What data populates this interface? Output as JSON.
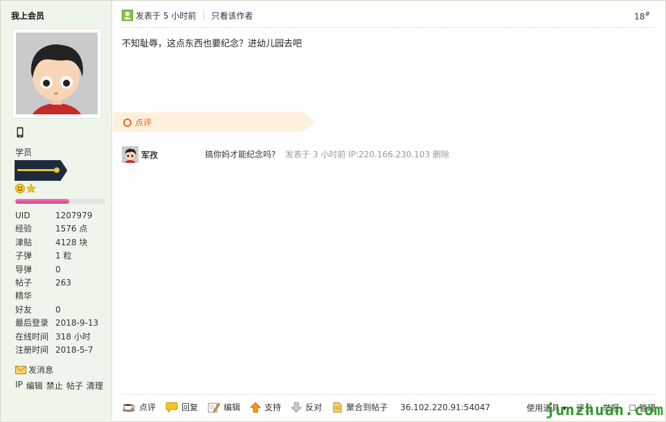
{
  "user": {
    "name": "我上会员",
    "rank": "学员",
    "progress_fraction": 0.6,
    "stats": [
      {
        "label": "UID",
        "value": "1207979"
      },
      {
        "label": "经验",
        "value": "1576 点"
      },
      {
        "label": "津贴",
        "value": "4128 块"
      },
      {
        "label": "子弹",
        "value": "1 粒"
      },
      {
        "label": "导弹",
        "value": "0"
      },
      {
        "label": "帖子",
        "value": "263"
      },
      {
        "label": "精华",
        "value": ""
      },
      {
        "label": "好友",
        "value": "0"
      },
      {
        "label": "最后登录",
        "value": "2018-9-13"
      },
      {
        "label": "在线时间",
        "value": "318 小时"
      },
      {
        "label": "注册时间",
        "value": "2018-5-7"
      }
    ],
    "send_message": "发消息",
    "admin_links": [
      "IP",
      "编辑",
      "禁止",
      "帖子",
      "清理"
    ]
  },
  "post": {
    "posted": "发表于 5 小时前",
    "only_author": "只看该作者",
    "floor": "18",
    "floor_mark": "#",
    "content": "不知耻辱，这点东西也要纪念？进幼儿园去吧"
  },
  "comments": {
    "title": "点评",
    "items": [
      {
        "user": "军孜",
        "text": "搞你妈才能纪念吗?",
        "meta": "发表于 3 小时前 IP:220.166.230.103",
        "delete": "删除"
      }
    ]
  },
  "actions": {
    "comment": "点评",
    "reply": "回复",
    "edit": "编辑",
    "support": "支持",
    "oppose": "反对",
    "aggregate": "聚合到帖子",
    "ip": "36.102.220.91:54047",
    "use_item": "使用道具",
    "rate": "评分",
    "report": "举报",
    "manage": "管理"
  },
  "watermark": "junzhuan.com",
  "colors": {
    "sidebar_bg": "#eef6ec",
    "accent_orange": "#e8661a",
    "banner_bg": "#fdf1dd",
    "watermark_green": "#2f9a2a",
    "progress_pink": "#d63b86"
  }
}
